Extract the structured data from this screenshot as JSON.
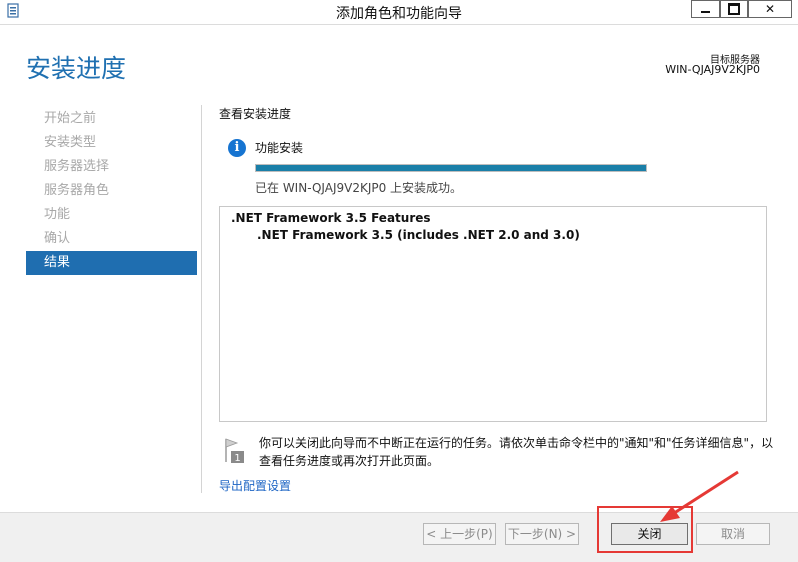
{
  "window": {
    "title": "添加角色和功能向导"
  },
  "header": {
    "page_title": "安装进度",
    "server_label": "目标服务器",
    "server_name": "WIN-QJAJ9V2KJP0"
  },
  "nav": {
    "items": [
      "开始之前",
      "安装类型",
      "服务器选择",
      "服务器角色",
      "功能",
      "确认",
      "结果"
    ],
    "active_index": 6
  },
  "main": {
    "section_label": "查看安装进度",
    "feature_title": "功能安装",
    "progress_fraction": 1.0,
    "status_text": "已在 WIN-QJAJ9V2KJP0 上安装成功。",
    "results": [
      ".NET Framework 3.5 Features",
      ".NET Framework 3.5 (includes .NET 2.0 and 3.0)"
    ],
    "note_text": "你可以关闭此向导而不中断正在运行的任务。请依次单击命令栏中的\"通知\"和\"任务详细信息\"，以查看任务进度或再次打开此页面。",
    "export_link": "导出配置设置"
  },
  "footer": {
    "prev_label": "< 上一步(P)",
    "next_label": "下一步(N) >",
    "finish_label": "关闭",
    "cancel_label": "取消"
  },
  "icons": {
    "app": "server-manager-icon",
    "info": "info-icon",
    "note": "flag-note-icon"
  },
  "colors": {
    "accent": "#1f6eb0",
    "title": "#1f70b1",
    "progress": "#1a7fa8",
    "annotation": "#e53935"
  }
}
